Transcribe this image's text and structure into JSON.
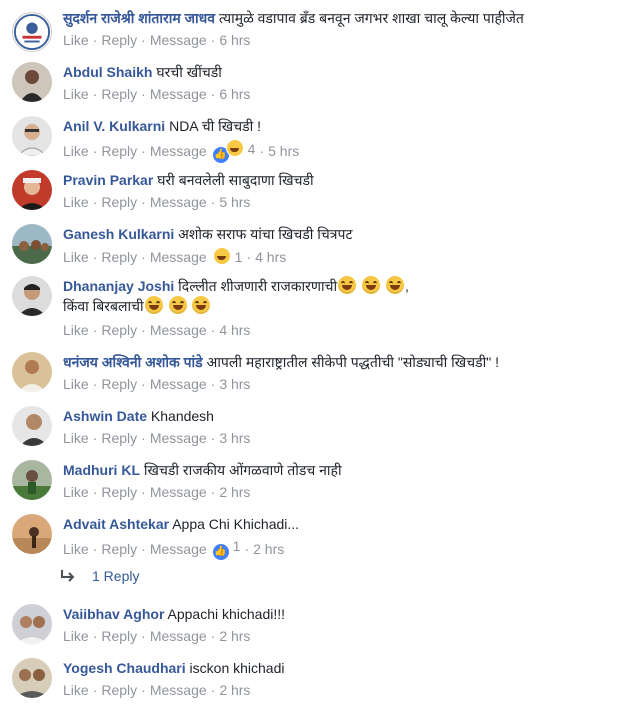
{
  "actions": {
    "like": "Like",
    "reply": "Reply",
    "message": "Message",
    "separator": "·"
  },
  "comments": [
    {
      "author": "सुदर्शन राजेश्री शांताराम जाधव",
      "text": "त्यामुळे वडापाव ब्रँड बनवून जगभर शाखा चालू केल्या पाहीजेत",
      "time": "6 hrs",
      "avatar_color": "#3b5d9a"
    },
    {
      "author": "Abdul Shaikh",
      "text": "घरची खींचडी",
      "time": "6 hrs",
      "avatar_color": "#6b4a3a"
    },
    {
      "author": "Anil V. Kulkarni",
      "text": "NDA ची खिचडी !",
      "time": "5 hrs",
      "reaction_count": "4",
      "avatar_color": "#8a8a8a"
    },
    {
      "author": "Pravin Parkar",
      "text": "घरी बनवलेली साबुदाणा खिचडी",
      "time": "5 hrs",
      "avatar_color": "#b23a2a"
    },
    {
      "author": "Ganesh Kulkarni",
      "text": "अशोक सराफ यांचा खिचडी चित्रपट",
      "time": "4 hrs",
      "reaction_count": "1",
      "avatar_color": "#5a7a6a"
    },
    {
      "author": "Dhananjay Joshi",
      "text": "दिल्लीत शीजणारी राजकारणाची",
      "text2": "किंवा बिरबलाची",
      "time": "4 hrs",
      "avatar_color": "#3a3a3a"
    },
    {
      "author": "धनंजय अश्विनी अशोक पांडे",
      "text": "आपली महाराष्ट्रातील सीकेपी पद्धतीची \"सोड्याची खिचडी\" !",
      "time": "3 hrs",
      "avatar_color": "#c8a06a"
    },
    {
      "author": "Ashwin Date",
      "text": "Khandesh",
      "time": "3 hrs",
      "avatar_color": "#4a4a4a"
    },
    {
      "author": "Madhuri KL",
      "text": "खिचडी राजकीय ओंगळवाणे तोडच नाही",
      "time": "2 hrs",
      "avatar_color": "#7a8a6a"
    },
    {
      "author": "Advait Ashtekar",
      "text": "Appa Chi Khichadi...",
      "time": "2 hrs",
      "reaction_count": "1",
      "avatar_color": "#c89060"
    },
    {
      "author": "Vaiibhav Aghor",
      "text": "Appachi khichadi!!!",
      "time": "2 hrs",
      "avatar_color": "#5a5a6a"
    },
    {
      "author": "Yogesh Chaudhari",
      "text": "isckon khichadi",
      "time": "2 hrs",
      "avatar_color": "#8a7a5a"
    }
  ],
  "replies_link": "1 Reply",
  "colors": {
    "author": "#365899",
    "meta": "#90949c",
    "text": "#1d2129",
    "like_blue": "#4080ff"
  }
}
